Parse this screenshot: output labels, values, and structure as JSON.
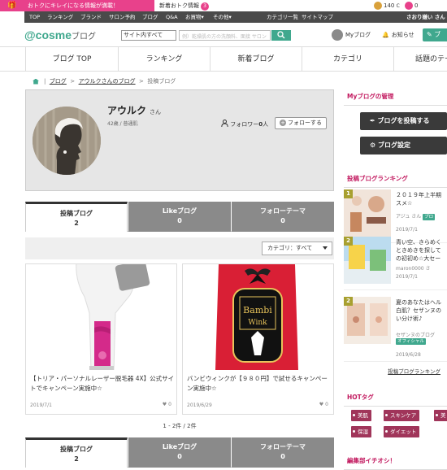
{
  "promo": {
    "banner": "おトクにキレイになる情報が満載！",
    "new_info": "新着おトク情報",
    "new_info_count": "3",
    "points": "140",
    "cosme_points": "0"
  },
  "dark_nav": {
    "items": [
      "TOP",
      "ランキング",
      "ブランド",
      "サロン予約",
      "ブログ",
      "Q&A",
      "お買物▾",
      "その他▾"
    ],
    "right_items": [
      "カテゴリ一覧",
      "サイトマップ"
    ],
    "user": "さおり嫌い さん"
  },
  "header": {
    "logo": "@cosme",
    "logo_sub": "ブログ",
    "scope": "サイト内すべて",
    "search_placeholder": "例）乾燥肌の方の洗顔料、面接 サロン",
    "myblog": "Myブログ",
    "notice": "お知らせ",
    "post": "ブ"
  },
  "main_nav": [
    "ブログ TOP",
    "ランキング",
    "新着ブログ",
    "カテゴリ",
    "話題のテー"
  ],
  "breadcrumb": [
    "ブログ",
    "アウルクさんのブログ",
    "投稿ブログ"
  ],
  "profile": {
    "name": "アウルク",
    "honorific": "さん",
    "meta": "42歳 / 普通肌",
    "follower_label": "フォロワー",
    "follower_count": "0",
    "follower_unit": "人",
    "follow_button": "フォローする"
  },
  "tabs": [
    {
      "label": "投稿ブログ",
      "count": "2"
    },
    {
      "label": "Likeブログ",
      "count": "0"
    },
    {
      "label": "フォローテーマ",
      "count": "0"
    }
  ],
  "filter": {
    "category": "カテゴリ：すべて"
  },
  "posts": [
    {
      "title": "【トリア・パーソナルレーザー脱毛器 4X】公式サイトでキャンペーン実施中☆",
      "date": "2019/7/1",
      "likes": "0"
    },
    {
      "title": "バンビウィンクが【９８０円】で試せるキャンペーン実施中☆",
      "date": "2019/6/29",
      "likes": "0"
    }
  ],
  "pager": "1 - 2件 / 2件",
  "sidebar": {
    "manage_title": "Myブログの管理",
    "post_button": "ブログを投稿する",
    "settings_button": "ブログ設定",
    "ranking_title": "投稿ブログランキング",
    "ranking": [
      {
        "rank": "1",
        "title": "２０１９年上半期",
        "title2": "スメ☆",
        "user": "アジュ さん",
        "badge": "プロ",
        "date": "2019/7/1"
      },
      {
        "rank": "2",
        "title": "青い空、きらめく",
        "title2": "ときめきを探して",
        "title3": "の初初め☆大セー",
        "user": "maron0000 さ",
        "date": "2019/7/1"
      },
      {
        "rank": "2",
        "title": "夏のあなたはヘル",
        "title2": "白肌？セザンヌの",
        "title3": "い分け術♪",
        "user": "セザンヌのブログ",
        "badge": "オフィシャル",
        "date": "2019/6/28"
      }
    ],
    "ranking_more": "投稿ブログランキング",
    "hot_tag_title": "HOTタグ",
    "tags": [
      "美肌",
      "スキンケア",
      "保湿",
      "ダイエット",
      "美"
    ],
    "pickup_title": "編集部イチオシ！"
  }
}
